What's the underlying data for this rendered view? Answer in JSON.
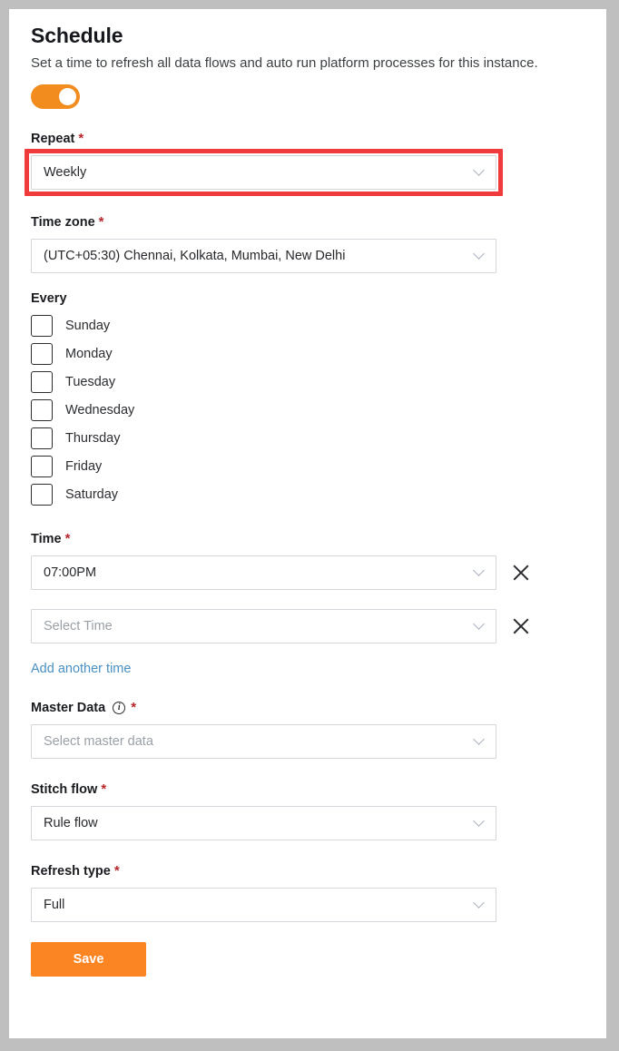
{
  "panel": {
    "title": "Schedule",
    "subtitle": "Set a time to refresh all data flows and auto run platform processes for this instance.",
    "enabled_toggle": {
      "name": "schedule-enabled-toggle",
      "state": "on",
      "color": "#f28c1e"
    }
  },
  "repeat": {
    "label": "Repeat",
    "required_marker": "*",
    "value": "Weekly",
    "highlighted": true,
    "highlight_color": "#ef3b3b"
  },
  "timezone": {
    "label": "Time zone",
    "required_marker": "*",
    "value": "(UTC+05:30) Chennai, Kolkata, Mumbai, New Delhi"
  },
  "every": {
    "label": "Every",
    "days": [
      {
        "label": "Sunday",
        "checked": false
      },
      {
        "label": "Monday",
        "checked": false
      },
      {
        "label": "Tuesday",
        "checked": false
      },
      {
        "label": "Wednesday",
        "checked": false
      },
      {
        "label": "Thursday",
        "checked": false
      },
      {
        "label": "Friday",
        "checked": false
      },
      {
        "label": "Saturday",
        "checked": false
      }
    ]
  },
  "time": {
    "label": "Time",
    "required_marker": "*",
    "rows": [
      {
        "value": "07:00PM",
        "is_placeholder": false,
        "remove_icon": "close-icon"
      },
      {
        "value": "Select Time",
        "is_placeholder": true,
        "remove_icon": "close-icon"
      }
    ],
    "add_link": "Add another time",
    "add_link_color": "#4a90c2"
  },
  "master_data": {
    "label": "Master Data",
    "info_icon": "info-circle-icon",
    "required_marker": "*",
    "value": "Select master data",
    "is_placeholder": true
  },
  "stitch_flow": {
    "label": "Stitch flow",
    "required_marker": "*",
    "value": "Rule flow"
  },
  "refresh_type": {
    "label": "Refresh type",
    "required_marker": "*",
    "value": "Full"
  },
  "actions": {
    "save_label": "Save",
    "save_color": "#fb8423"
  }
}
